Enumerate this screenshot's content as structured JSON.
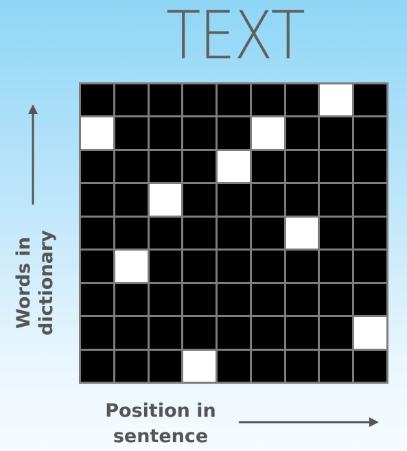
{
  "title": "TEXT",
  "y_axis_label": [
    "Words in",
    "dictionary"
  ],
  "x_axis_label": [
    "Position in",
    "sentence"
  ],
  "grid": {
    "rows": 9,
    "columns": 9,
    "cell_color": "#000000",
    "active_cell_color": "#ffffff",
    "grid_line_color": "#7d7d7d",
    "active_cells_column_per_row": [
      7,
      0,
      4,
      2,
      6,
      1,
      null,
      8,
      3
    ],
    "extra_active_cells": [
      [
        1,
        5
      ]
    ]
  },
  "colors": {
    "text": "#555555",
    "title": "#5f5f5f",
    "background_top": "#8fd6f6",
    "background_bottom": "#f7fbff"
  }
}
